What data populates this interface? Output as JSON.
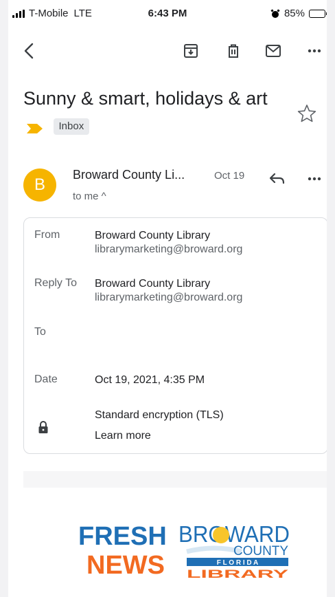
{
  "status_bar": {
    "carrier": "T-Mobile",
    "network": "LTE",
    "time": "6:43 PM",
    "battery_percent": "85%",
    "battery_level": 0.85
  },
  "toolbar": {
    "back_icon": "chevron-left-icon",
    "archive_icon": "archive-icon",
    "delete_icon": "trash-icon",
    "mark_unread_icon": "mail-icon",
    "more_icon": "more-horizontal-icon"
  },
  "email": {
    "subject": "Sunny & smart, holidays & art",
    "label": "Inbox",
    "sender_initial": "B",
    "sender_name": "Broward County Li...",
    "date_short": "Oct 19",
    "recipient_summary": "to me ^"
  },
  "details": {
    "from_label": "From",
    "from_name": "Broward County Library",
    "from_email": "librarymarketing@broward.org",
    "reply_to_label": "Reply To",
    "reply_to_name": "Broward County Library",
    "reply_to_email": "librarymarketing@broward.org",
    "to_label": "To",
    "date_label": "Date",
    "date_value": "Oct 19, 2021, 4:35 PM",
    "encryption": "Standard encryption (TLS)",
    "learn_more": "Learn more"
  },
  "logo": {
    "line1": "FRESH",
    "line2": "NEWS",
    "brand_top": "BROWARD",
    "brand_county": "COUNTY",
    "brand_florida": "F L O R I D A",
    "brand_library": "LIBRARY"
  },
  "colors": {
    "avatar": "#f6b400",
    "label_arrow": "#f6b400",
    "link": "#1a73e8",
    "logo_blue": "#1f6fb5",
    "logo_orange": "#f26a21"
  }
}
